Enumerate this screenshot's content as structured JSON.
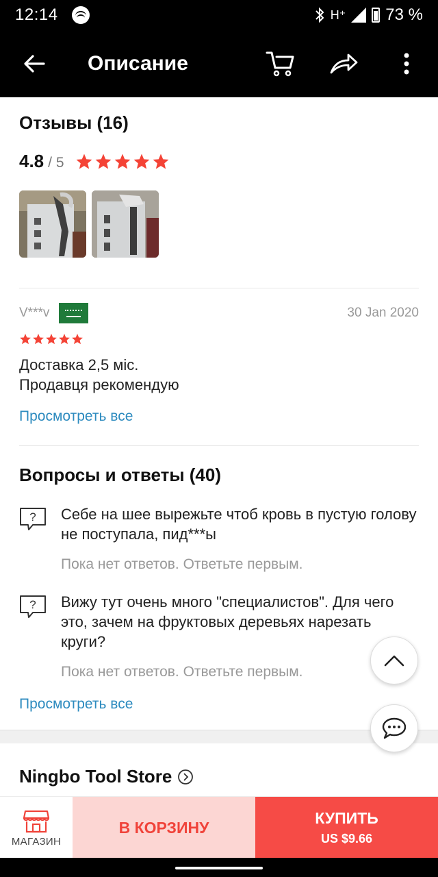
{
  "status_bar": {
    "time": "12:14",
    "network": "H⁺",
    "battery": "73 %"
  },
  "app_bar": {
    "title": "Описание"
  },
  "reviews": {
    "title": "Отзывы (16)",
    "rating": "4.8",
    "rating_max": "/ 5",
    "stars": 5,
    "photos": [
      "review-photo-1",
      "review-photo-2"
    ],
    "item": {
      "user": "V***v",
      "date": "30 Jan 2020",
      "stars": 5,
      "line1": "Доставка 2,5 міс.",
      "line2": "Продавця рекомендую"
    },
    "view_all": "Просмотреть все"
  },
  "qa": {
    "title": "Вопросы и ответы (40)",
    "items": [
      {
        "question": "Себе на шее вырежьте чтоб кровь в пустую голову не поступала, пид***ы",
        "status": "Пока нет ответов. Ответьте первым."
      },
      {
        "question": "Вижу тут очень много \"специалистов\". Для чего это, зачем на фруктовых деревьях нарезать круги?",
        "status": "Пока нет ответов. Ответьте первым."
      }
    ],
    "view_all": "Просмотреть все"
  },
  "store": {
    "name": "Ningbo Tool Store"
  },
  "bottom_bar": {
    "shop_label": "МАГАЗИН",
    "cart_label": "В КОРЗИНУ",
    "buy_label": "КУПИТЬ",
    "buy_price": "US $9.66"
  },
  "colors": {
    "accent": "#f64b46",
    "cart_bg": "#fcd6d3",
    "link": "#2d8bbf",
    "star": "#f44336"
  }
}
